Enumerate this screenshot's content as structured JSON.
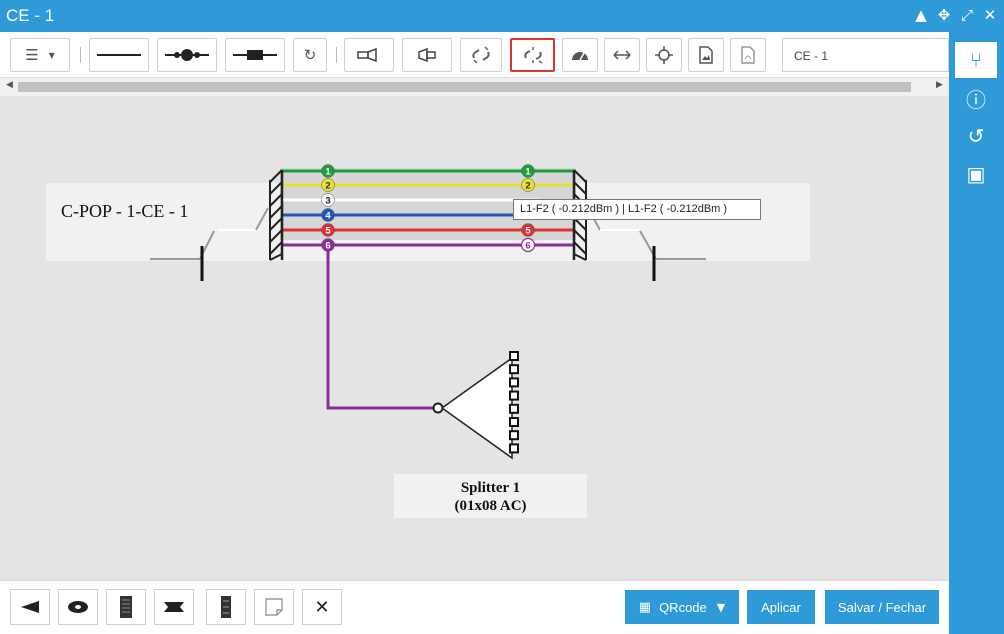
{
  "window": {
    "title": "CE - 1"
  },
  "title_controls": [
    "▲",
    "✥",
    "⤢",
    "✕"
  ],
  "toolbar": {
    "list_icon": "☰",
    "dropdown_icon": "▾",
    "refresh_icon": "↻",
    "name_value": "CE - 1"
  },
  "sidebar": {
    "icons": [
      "fork-icon",
      "info-icon",
      "history-icon",
      "image-icon"
    ],
    "glyphs": [
      "⑂",
      "ⓘ",
      "↺",
      "▣"
    ]
  },
  "diagram": {
    "box_label": "C-POP - 1-CE - 1",
    "tooltip": "L1-F2 ( -0.212dBm ) | L1-F2 ( -0.212dBm )",
    "splitter_name": "Splitter 1",
    "splitter_type": "(01x08 AC)",
    "fibers_left": [
      {
        "num": "1",
        "color": "#1e9e3a",
        "text_color": "#ffffff"
      },
      {
        "num": "2",
        "color": "#e8e030",
        "text_color": "#333333"
      },
      {
        "num": "3",
        "color": "#ffffff",
        "text_color": "#222222"
      },
      {
        "num": "4",
        "color": "#2456b8",
        "text_color": "#ffffff"
      },
      {
        "num": "5",
        "color": "#e03232",
        "text_color": "#ffffff"
      },
      {
        "num": "6",
        "color": "#8a2e9a",
        "text_color": "#ffffff"
      }
    ],
    "fibers_right": [
      {
        "num": "1",
        "color": "#1e9e3a",
        "text_color": "#ffffff"
      },
      {
        "num": "2",
        "color": "#e8e030",
        "text_color": "#333333"
      },
      {
        "num": "5",
        "color": "#e03232",
        "text_color": "#ffffff"
      },
      {
        "num": "6",
        "color": "#ffffff",
        "text_color": "#8a2e9a"
      }
    ],
    "splitter_ports": [
      "1",
      "2",
      "3",
      "4",
      "5",
      "6",
      "7",
      "8"
    ]
  },
  "bottom": {
    "qrcode_label": "QRcode",
    "qrcode_icon": "▦",
    "apply_label": "Aplicar",
    "save_close_label": "Salvar / Fechar",
    "delete_icon": "✕"
  },
  "colors": {
    "accent": "#2e9ad8",
    "active_border": "#e03030"
  }
}
